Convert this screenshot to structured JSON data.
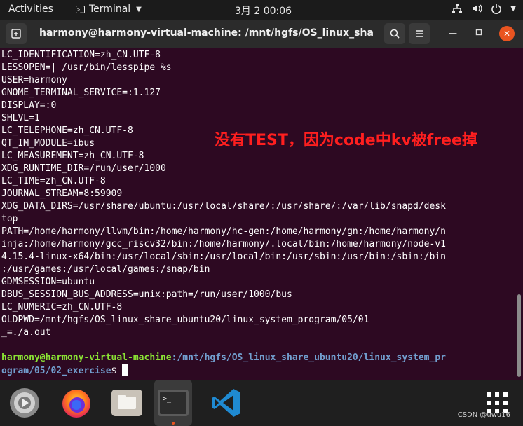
{
  "topbar": {
    "activities": "Activities",
    "app_name": "Terminal",
    "clock": "3月 2  00:06"
  },
  "window": {
    "title": "harmony@harmony-virtual-machine: /mnt/hgfs/OS_linux_share_...",
    "new_tab_icon": "new-tab-icon",
    "search_icon": "search-icon",
    "menu_icon": "hamburger-icon"
  },
  "terminal": {
    "lines": [
      "LC_IDENTIFICATION=zh_CN.UTF-8",
      "LESSOPEN=| /usr/bin/lesspipe %s",
      "USER=harmony",
      "GNOME_TERMINAL_SERVICE=:1.127",
      "DISPLAY=:0",
      "SHLVL=1",
      "LC_TELEPHONE=zh_CN.UTF-8",
      "QT_IM_MODULE=ibus",
      "LC_MEASUREMENT=zh_CN.UTF-8",
      "XDG_RUNTIME_DIR=/run/user/1000",
      "LC_TIME=zh_CN.UTF-8",
      "JOURNAL_STREAM=8:59909",
      "XDG_DATA_DIRS=/usr/share/ubuntu:/usr/local/share/:/usr/share/:/var/lib/snapd/desk",
      "top",
      "PATH=/home/harmony/llvm/bin:/home/harmony/hc-gen:/home/harmony/gn:/home/harmony/n",
      "inja:/home/harmony/gcc_riscv32/bin:/home/harmony/.local/bin:/home/harmony/node-v1",
      "4.15.4-linux-x64/bin:/usr/local/sbin:/usr/local/bin:/usr/sbin:/usr/bin:/sbin:/bin",
      ":/usr/games:/usr/local/games:/snap/bin",
      "GDMSESSION=ubuntu",
      "DBUS_SESSION_BUS_ADDRESS=unix:path=/run/user/1000/bus",
      "LC_NUMERIC=zh_CN.UTF-8",
      "OLDPWD=/mnt/hgfs/OS_linux_share_ubuntu20/linux_system_program/05/01",
      "_=./a.out",
      ""
    ],
    "prompt_user": "harmony@harmony-virtual-machine",
    "prompt_path_line1": ":/mnt/hgfs/OS_linux_share_ubuntu20/linux_system_pr",
    "prompt_path_line2": "ogram/05/02_exercise",
    "prompt_symbol": "$ ",
    "annotation": "没有TEST，因为code中kv被free掉",
    "colors": {
      "background": "#2d0922",
      "user": "#8ae234",
      "path": "#729fcf",
      "annotation": "#ff1f1f"
    }
  },
  "dock": {
    "items": [
      "help-icon",
      "firefox-icon",
      "files-icon",
      "terminal-icon",
      "vscode-icon",
      "show-apps-icon"
    ],
    "watermark": "CSDN @uwu16"
  }
}
